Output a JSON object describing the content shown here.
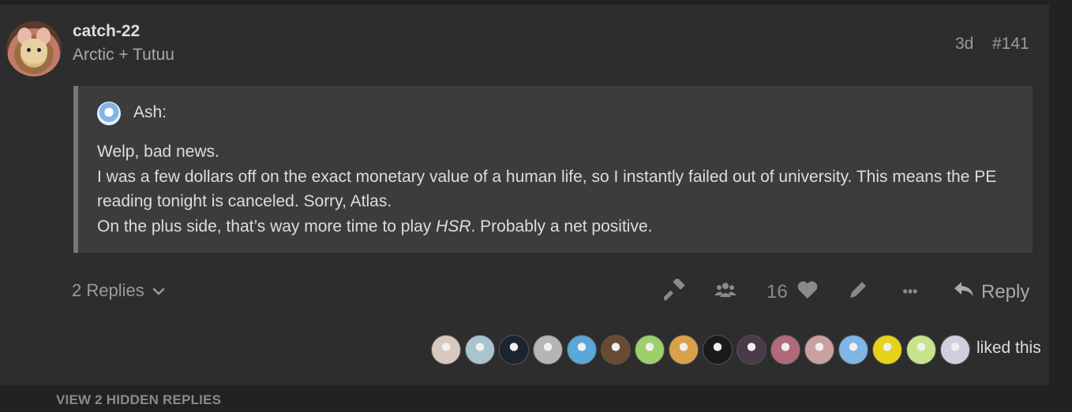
{
  "post": {
    "username": "catch-22",
    "user_title": "Arctic + Tutuu",
    "age": "3d",
    "post_number": "#141"
  },
  "quote": {
    "author": "Ash:",
    "lines": [
      "Welp, bad news.",
      "I was a few dollars off on the exact monetary value of a human life, so I instantly failed out of university. This means the PE reading tonight is canceled. Sorry, Atlas."
    ],
    "line3_before": "On the plus side, that’s way more time to play ",
    "line3_em": "HSR",
    "line3_after": ". Probably a net positive."
  },
  "actions": {
    "replies_label": "2 Replies",
    "like_count": "16",
    "reply_label": "Reply",
    "more_label": "•••"
  },
  "likers": {
    "text": "liked this",
    "avatar_colors": [
      "#d8c8c0",
      "#a9c3cf",
      "#1b2430",
      "#b5b5b5",
      "#5aa7d8",
      "#6b4a32",
      "#9bd06a",
      "#d9a24a",
      "#1a1a1a",
      "#4a3a4a",
      "#b06a7a",
      "#c9a0a0",
      "#7fb6e6",
      "#e6d21a",
      "#c8e38a",
      "#d0cfe0"
    ]
  },
  "footer": {
    "hidden_replies": "VIEW 2 HIDDEN REPLIES"
  }
}
